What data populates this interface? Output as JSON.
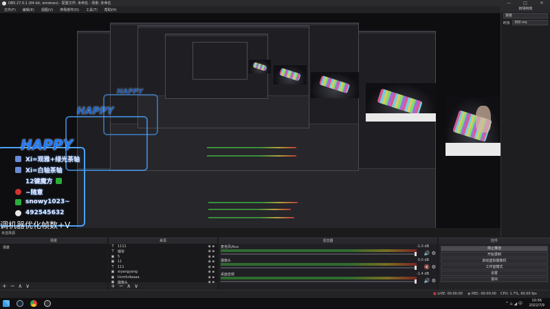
{
  "titlebar": {
    "title": "OBS 27.0.1 (64-bit, windows) - 配置文件: 未命名 - 场景: 未命名",
    "minimize": "—",
    "maximize": "□",
    "close": "✕"
  },
  "menu": [
    "文件(F)",
    "编辑(E)",
    "视图(V)",
    "停靠部件(D)",
    "工具(T)",
    "帮助(H)"
  ],
  "overlay": {
    "happy": "HAPPY",
    "lines": [
      "Xi=观雅+绿光茶轴",
      "Xi=白轴茶轴",
      "12键魔方",
      "~随意",
      "snowy1023~",
      "492545632"
    ],
    "caption": "调机器优化帧数+V",
    "caption_small": "未选择源"
  },
  "scenes": {
    "header": "场景",
    "items": [
      "场景"
    ]
  },
  "sources": {
    "header": "来源",
    "items": [
      {
        "label": "1111",
        "icon": "T"
      },
      {
        "label": "钢琴",
        "icon": "T"
      },
      {
        "label": "5",
        "icon": "▣"
      },
      {
        "label": "11",
        "icon": "▣"
      },
      {
        "label": "111",
        "icon": "T"
      },
      {
        "label": "xiyangyang",
        "icon": "▣"
      },
      {
        "label": "Ucmfu4aaaa",
        "icon": "▣"
      },
      {
        "label": "摄像头",
        "icon": "▣"
      }
    ]
  },
  "mixer": {
    "header": "混音器",
    "channels": [
      {
        "name": "麦克风/Aux",
        "db": "-1.0 dB"
      },
      {
        "name": "摄像头",
        "db": "0.0 dB"
      },
      {
        "name": "桌面音频",
        "db": "-1.4 dB"
      }
    ]
  },
  "controls": {
    "header": "控件",
    "buttons": [
      "停止推流",
      "开始录制",
      "启动虚拟摄像机",
      "工作室模式",
      "设置",
      "退出"
    ],
    "active_index": 0
  },
  "transitions": {
    "header": "转场特效",
    "type": "渐变",
    "duration_label": "时长",
    "duration": "300 ms"
  },
  "status": {
    "live": "LIVE: 00:00:00",
    "rec": "REC: 00:00:00",
    "cpu": "CPU: 1.7%, 60.00 fps"
  },
  "taskbar": {
    "time": "10:56",
    "date": "2022/7/9",
    "tray": "^ ⌂ ◢ 中"
  },
  "footer_controls": [
    "+",
    "−",
    "∧",
    "∨"
  ],
  "colors": {
    "accent": "#4aa3ff",
    "live_red": "#c23b3b",
    "rec_gray": "#7a7a7a"
  }
}
